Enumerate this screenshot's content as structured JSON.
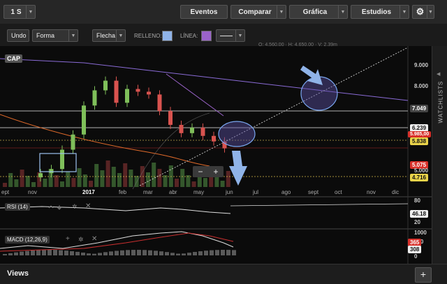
{
  "toolbar": {
    "period": "1 S",
    "events": "Eventos",
    "compare": "Comparar",
    "chart": "Gráfica",
    "studies": "Estudios",
    "gear": "⚙"
  },
  "drawbar": {
    "undo": "Undo",
    "shape": "Forma",
    "arrow": "Flecha",
    "fill_label": "RELLENO:",
    "line_label": "LÍNEA:",
    "fill_color": "#8fb3e8",
    "line_color": "#9a63c9",
    "ohlc_text": "O: 4.560,00 · H: 4.650,00 · V: 2.39m"
  },
  "chart": {
    "symbol": "CAP",
    "y_ticks": [
      "9.000",
      "8.000",
      "7.049",
      "6.239",
      "5.985,00",
      "5.838",
      "5.075",
      "5.000",
      "4.716"
    ],
    "x_ticks": [
      "ept",
      "nov",
      "2017",
      "feb",
      "mar",
      "abr",
      "may",
      "jun",
      "jul",
      "ago",
      "sept",
      "oct",
      "nov",
      "dic"
    ],
    "zoom_minus": "−",
    "zoom_plus": "+",
    "rsi_label": "RSI (14)",
    "rsi_ticks": [
      "80",
      "46.18",
      "20"
    ],
    "macd_label": "MACD (12,26,9)",
    "macd_ticks": [
      "1000",
      "500",
      "308",
      "0"
    ],
    "macd_red_badge": "365"
  },
  "sidebar": {
    "watchlists": "WATCHLISTS"
  },
  "footer": {
    "views": "Views",
    "add": "+"
  },
  "colors": {
    "up": "#7fbf5a",
    "down": "#d9534f",
    "accent_blue": "#7aa7f0",
    "ellipse": "#5b4fa3"
  },
  "chart_data": {
    "type": "line",
    "title": "CAP",
    "series": [
      {
        "name": "",
        "values": [
          5050,
          5200,
          5900,
          6450,
          7500,
          8050,
          8400,
          7600,
          8100,
          8000,
          7900,
          7300,
          6800,
          6500,
          6700,
          6400,
          6200,
          5950
        ]
      }
    ],
    "ylim": [
      4600,
      9300
    ]
  }
}
